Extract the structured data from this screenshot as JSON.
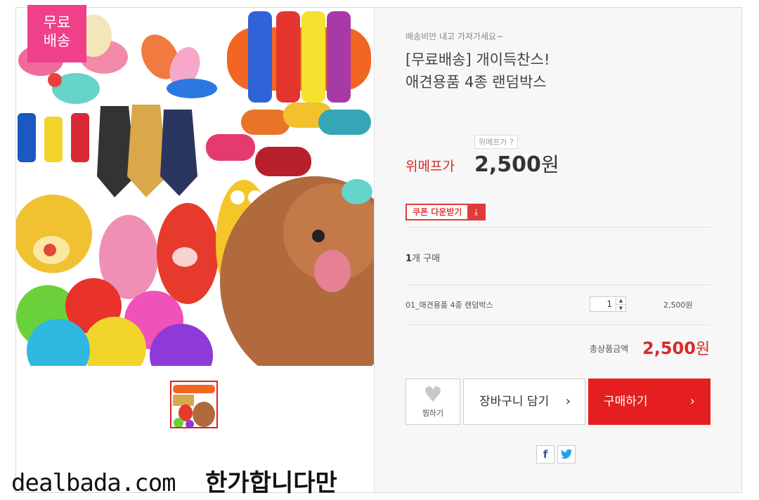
{
  "badge": {
    "line1": "무료",
    "line2": "배송"
  },
  "product": {
    "tagline": "배송비만 내고 가져가세요~",
    "title_line1": "[무료배송] 개이득찬스!",
    "title_line2": "애견용품 4종 랜덤박스"
  },
  "price": {
    "label_box": "위메프가 ?",
    "label": "위메프가",
    "amount": "2,500",
    "currency": "원"
  },
  "coupon": {
    "label": "쿠폰 다운받기",
    "icon": "download-icon"
  },
  "quantity": {
    "count": "1",
    "unit": "개 구매"
  },
  "option": {
    "name": "01_애견용품 4종 랜덤박스",
    "qty": "1",
    "price": "2,500원"
  },
  "total": {
    "label": "총상품금액",
    "amount": "2,500",
    "currency": "원"
  },
  "buttons": {
    "wish": "찜하기",
    "cart": "장바구니 담기",
    "buy": "구매하기"
  },
  "share": {
    "facebook": "f",
    "twitter": "twitter-icon"
  },
  "watermark": {
    "site": "dealbada.com",
    "comment": "한가합니다만"
  },
  "colors": {
    "accent": "#e51f1f",
    "badge": "#f0408a",
    "price_red": "#d62a2a"
  }
}
